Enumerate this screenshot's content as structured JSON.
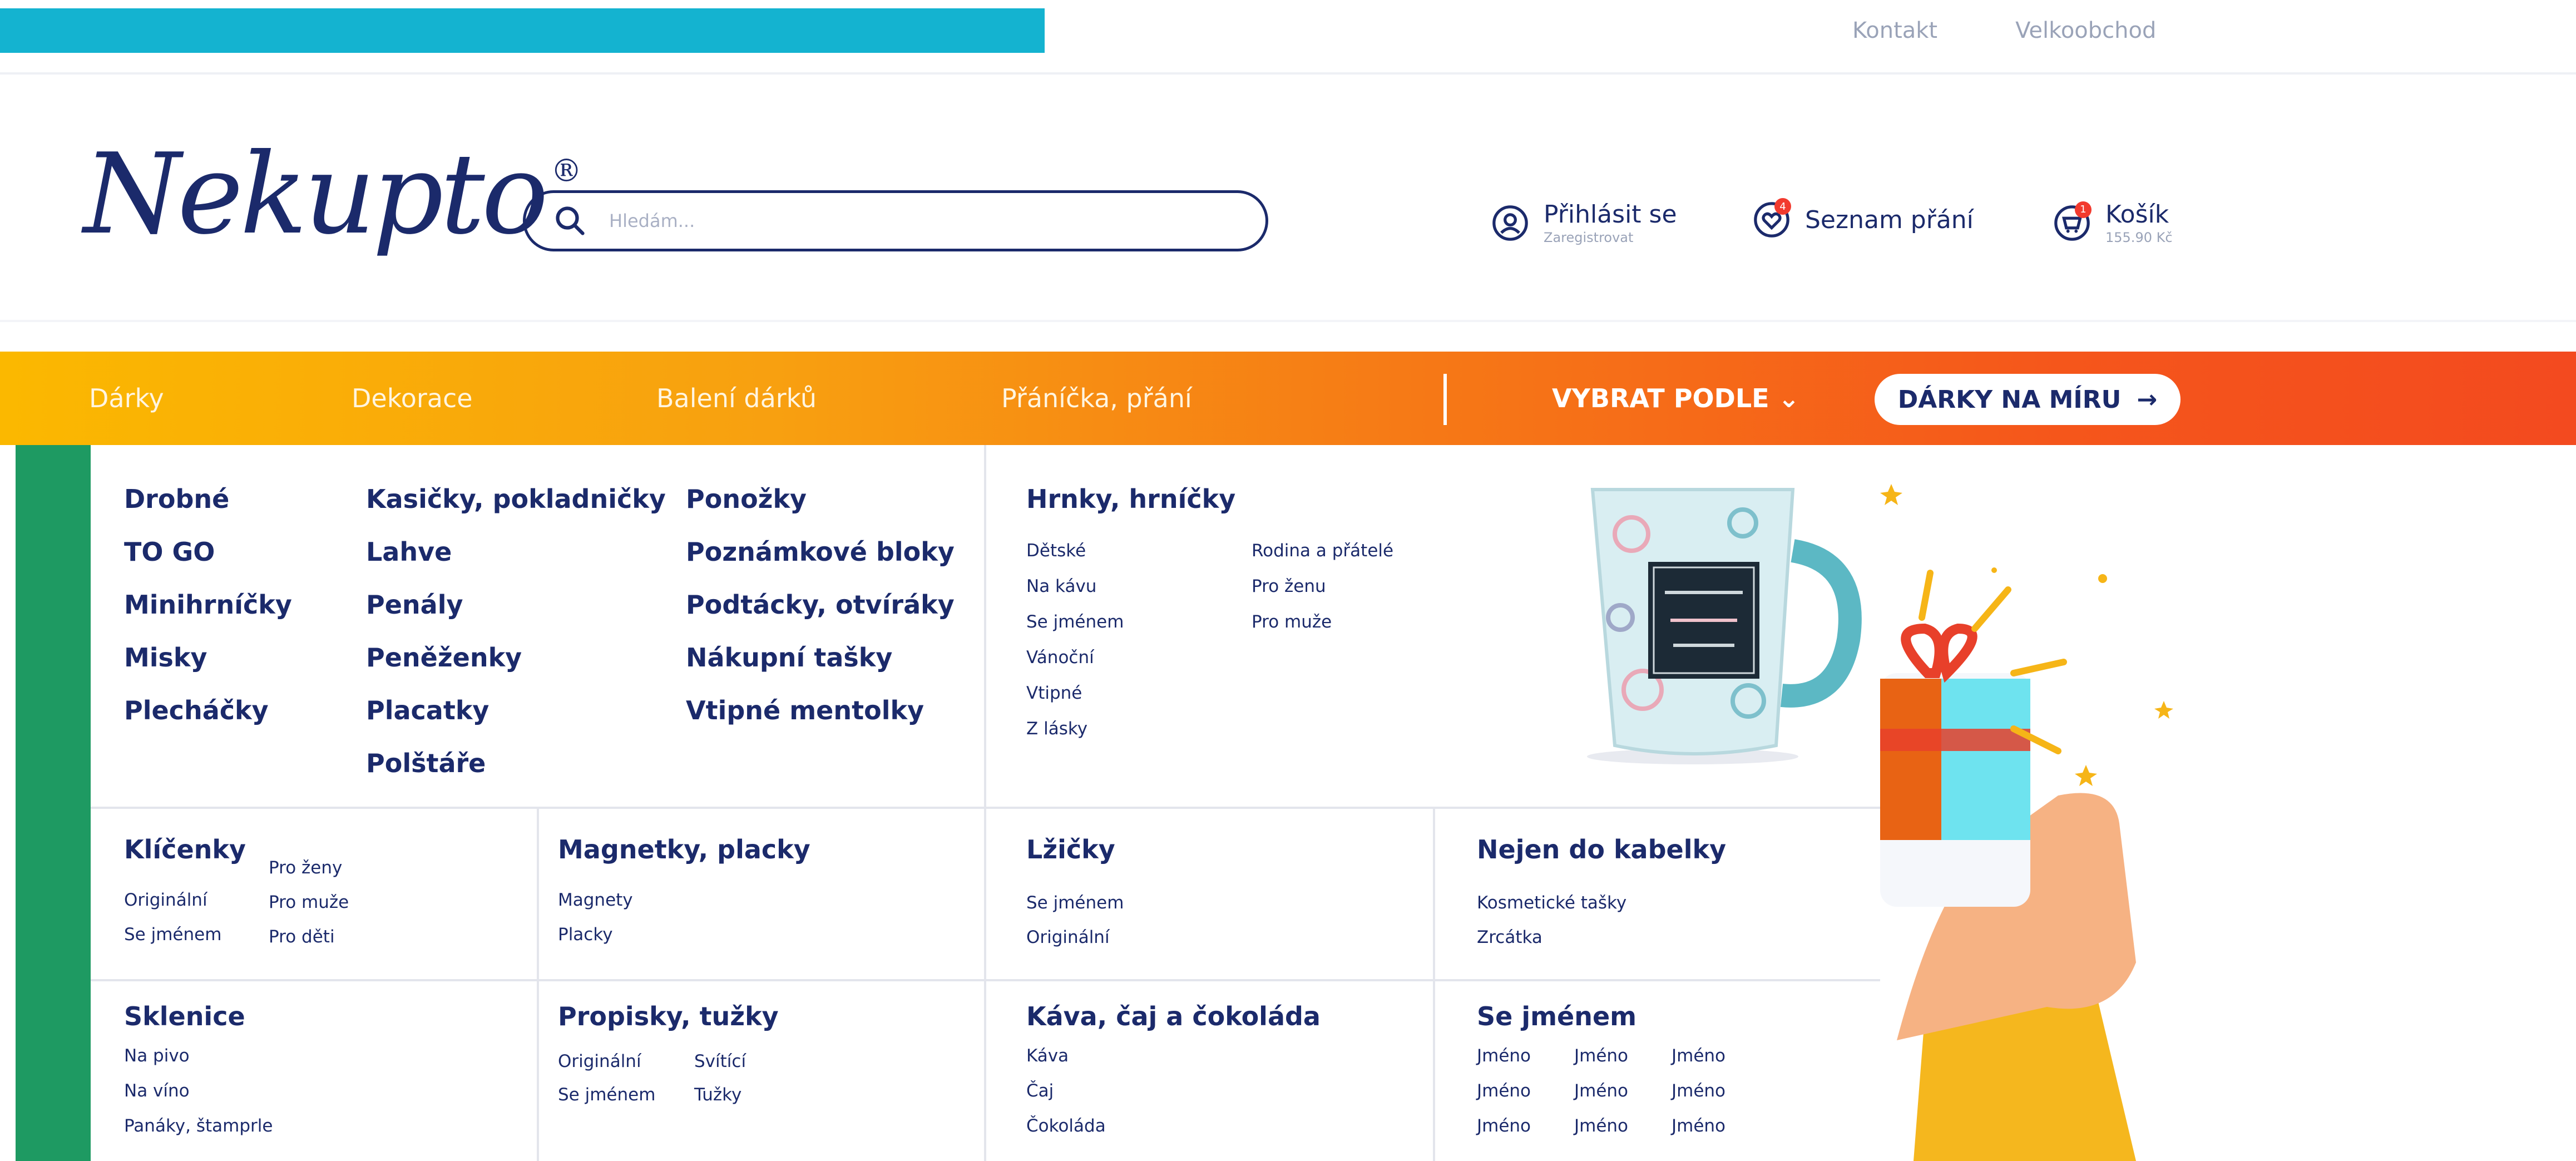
{
  "top_links": [
    "Kontakt",
    "Velkoobchod"
  ],
  "logo": {
    "text": "Nekupto",
    "registered": "®"
  },
  "search": {
    "placeholder": "Hledám..."
  },
  "header": {
    "login": {
      "label": "Přihlásit se",
      "sub": "Zaregistrovat"
    },
    "wishlist": {
      "label": "Seznam přání",
      "badge": "4"
    },
    "cart": {
      "label": "Košík",
      "sub": "155.90 Kč",
      "badge": "1"
    }
  },
  "nav": {
    "items": [
      "Dárky",
      "Dekorace",
      "Balení dárků",
      "Přáníčka, přání"
    ],
    "pick_label": "VYBRAT PODLE",
    "cta_label": "DÁRKY NA MÍRU"
  },
  "menu": {
    "col1": [
      "Drobné",
      "TO GO",
      "Minihrníčky",
      "Misky",
      "Plecháčky"
    ],
    "col2": [
      "Kasičky, pokladničky",
      "Lahve",
      "Penály",
      "Peněženky",
      "Placatky",
      "Polštáře"
    ],
    "col3": [
      "Ponožky",
      "Poznámkové bloky",
      "Podtácky, otvíráky",
      "Nákupní tašky",
      "Vtipné mentolky"
    ],
    "mugs": {
      "title": "Hrnky, hrníčky",
      "left": [
        "Dětské",
        "Na kávu",
        "Se jménem",
        "Vánoční",
        "Vtipné",
        "Z lásky"
      ],
      "right": [
        "Rodina a přátelé",
        "Pro ženu",
        "Pro muže"
      ]
    },
    "keychains": {
      "title": "Klíčenky",
      "left": [
        "Originální",
        "Se jménem"
      ],
      "right": [
        "Pro ženy",
        "Pro muže",
        "Pro děti"
      ]
    },
    "magnets": {
      "title": "Magnetky, placky",
      "items": [
        "Magnety",
        "Placky"
      ]
    },
    "spoons": {
      "title": "Lžičky",
      "items": [
        "Se jménem",
        "Originální"
      ]
    },
    "purse": {
      "title": "Nejen do kabelky",
      "items": [
        "Kosmetické tašky",
        "Zrcátka"
      ]
    },
    "glasses": {
      "title": "Sklenice",
      "items": [
        "Na pivo",
        "Na víno",
        "Panáky, štamprle"
      ]
    },
    "pens": {
      "title": "Propisky, tužky",
      "left": [
        "Originální",
        "Se jménem"
      ],
      "right": [
        "Svítící",
        "Tužky"
      ]
    },
    "coffee": {
      "title": "Káva, čaj a čokoláda",
      "items": [
        "Káva",
        "Čaj",
        "Čokoláda"
      ]
    },
    "named": {
      "title": "Se jménem",
      "items": [
        "Jméno",
        "Jméno",
        "Jméno",
        "Jméno",
        "Jméno",
        "Jméno",
        "Jméno",
        "Jméno",
        "Jméno"
      ]
    }
  },
  "colors": {
    "brand_navy": "#1b2a6b",
    "top_strip": "#14b3d0",
    "nav_start": "#fbb800",
    "nav_end": "#f34a1f",
    "green": "#1e9a62"
  }
}
